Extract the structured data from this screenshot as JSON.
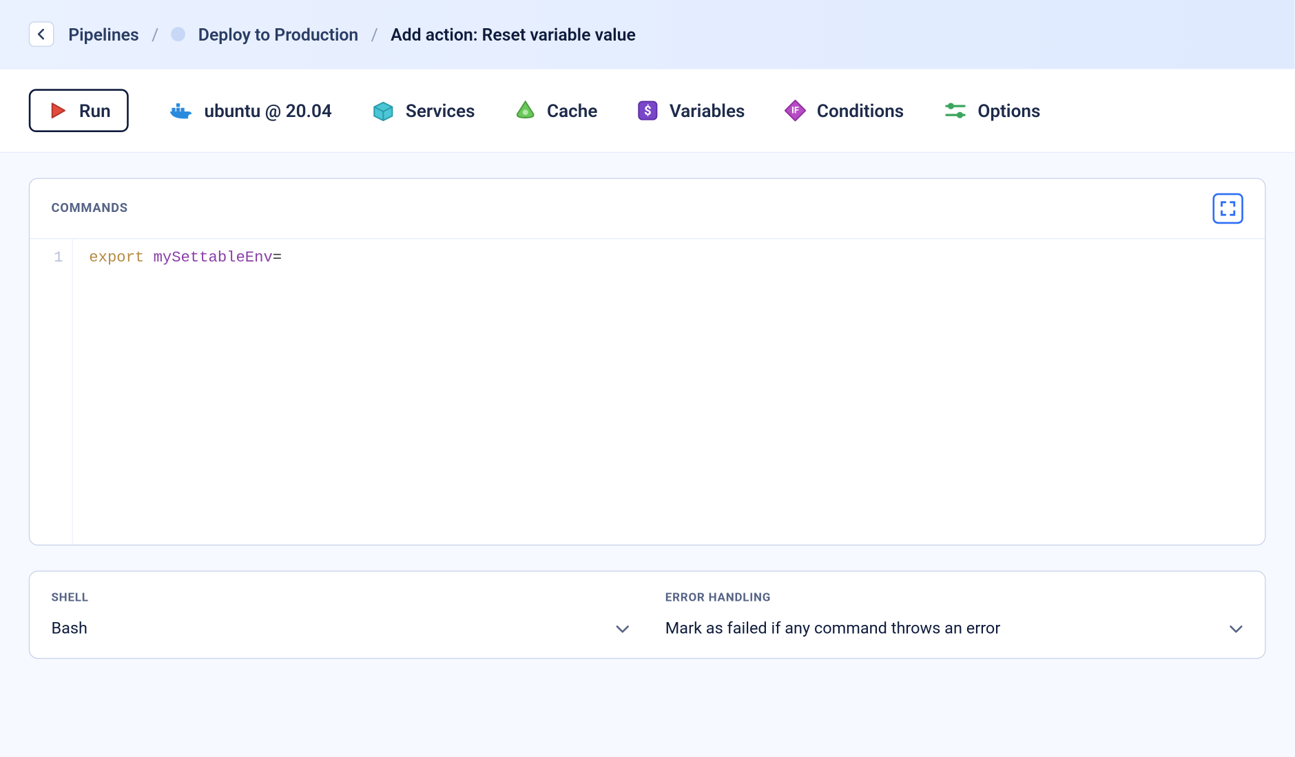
{
  "breadcrumb": {
    "root": "Pipelines",
    "pipeline": "Deploy to Production",
    "current": "Add action: Reset variable value"
  },
  "tabs": {
    "run": "Run",
    "env": "ubuntu @ 20.04",
    "services": "Services",
    "cache": "Cache",
    "variables": "Variables",
    "conditions": "Conditions",
    "options": "Options"
  },
  "commands_panel": {
    "title": "COMMANDS"
  },
  "editor": {
    "line_number": "1",
    "keyword": "export",
    "varname": "mySettableEnv",
    "op": "="
  },
  "shell": {
    "label": "SHELL",
    "value": "Bash"
  },
  "error_handling": {
    "label": "ERROR HANDLING",
    "value": "Mark as failed if any command throws an error"
  }
}
